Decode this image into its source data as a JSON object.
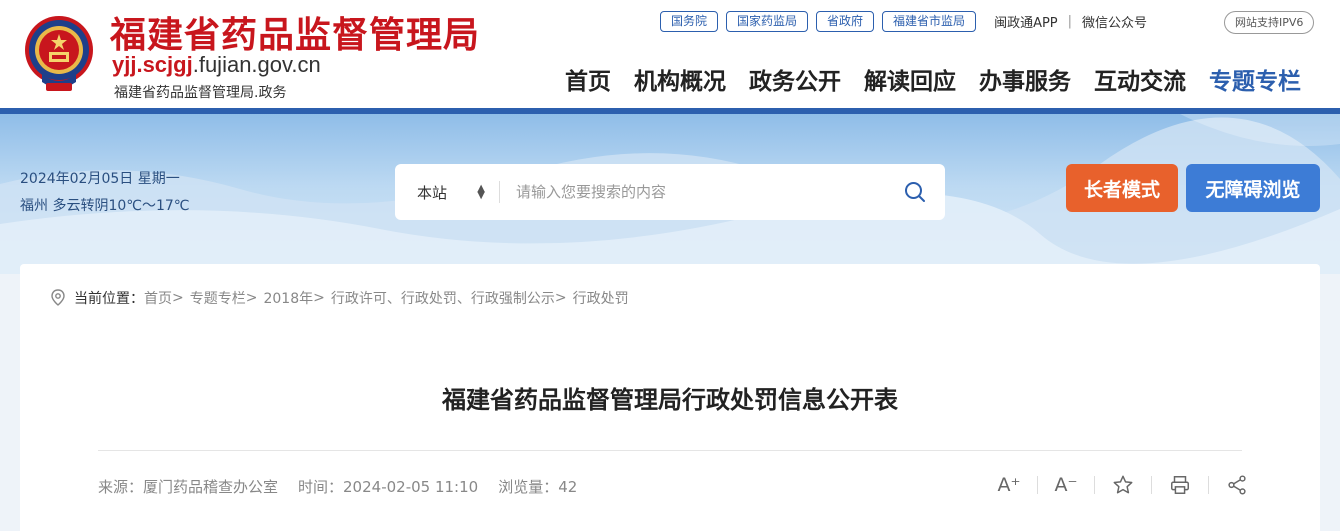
{
  "header": {
    "title": "福建省药品监督管理局",
    "url_red": "yjj.scjgj",
    "url_rest": ".fujian.gov.cn",
    "subtitle": "福建省药品监督管理局.政务",
    "top_links": [
      "国务院",
      "国家药监局",
      "省政府",
      "福建省市监局"
    ],
    "app_link": "闽政通APP",
    "separator": "|",
    "wechat_link": "微信公众号",
    "ipv6_badge": "网站支持IPV6",
    "colors": {
      "brand_red": "#c8161d",
      "brand_blue": "#2c5fae"
    }
  },
  "nav": {
    "items": [
      "首页",
      "机构概况",
      "政务公开",
      "解读回应",
      "办事服务",
      "互动交流",
      "专题专栏"
    ],
    "active_index": 6
  },
  "banner": {
    "date": "2024年02月05日 星期一",
    "weather": "福州 多云转阴10℃～17℃",
    "search": {
      "scope": "本站",
      "placeholder": "请输入您要搜索的内容"
    },
    "elder_mode": "长者模式",
    "accessible": "无障碍浏览",
    "colors": {
      "elder": "#e8612c",
      "accessible": "#3d7cd6"
    }
  },
  "breadcrumb": {
    "label": "当前位置：",
    "items": [
      "首页",
      "专题专栏",
      "2018年",
      "行政许可、行政处罚、行政强制公示",
      "行政处罚"
    ],
    "separator": ">"
  },
  "article": {
    "title": "福建省药品监督管理局行政处罚信息公开表",
    "source": "来源：厦门药品稽查办公室",
    "time": "时间：2024-02-05 11:10",
    "views": "浏览量：42",
    "tools": {
      "font_increase": "A⁺",
      "font_decrease": "A⁻"
    }
  }
}
